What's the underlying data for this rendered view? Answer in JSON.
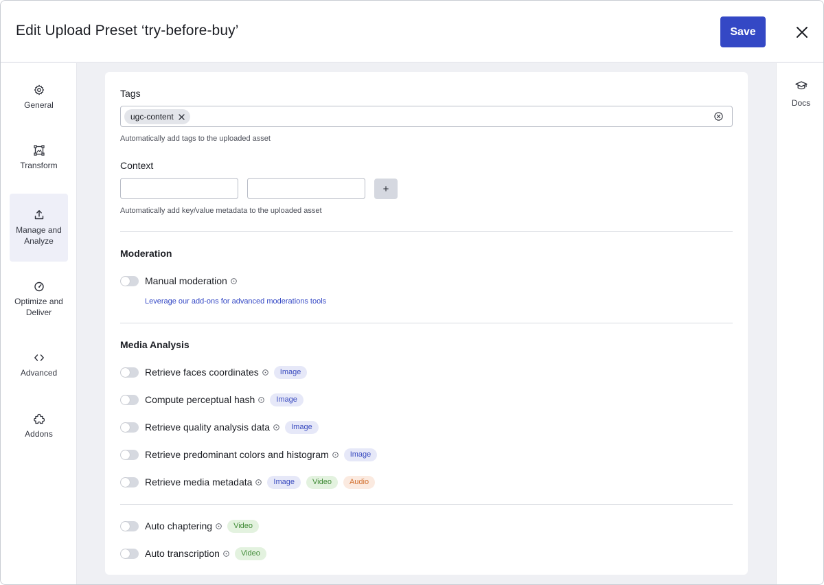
{
  "header": {
    "title": "Edit Upload Preset ‘try-before-buy’",
    "save_label": "Save"
  },
  "sidebar": {
    "items": [
      {
        "label": "General",
        "icon": "gear-icon"
      },
      {
        "label": "Transform",
        "icon": "crop-icon"
      },
      {
        "label": "Manage and Analyze",
        "icon": "upload-icon",
        "active": true
      },
      {
        "label": "Optimize and Deliver",
        "icon": "gauge-icon"
      },
      {
        "label": "Advanced",
        "icon": "code-icon"
      },
      {
        "label": "Addons",
        "icon": "puzzle-icon"
      }
    ]
  },
  "right_rail": {
    "docs_label": "Docs",
    "docs_icon": "graduation-cap-icon"
  },
  "tags": {
    "label": "Tags",
    "chips": [
      "ugc-content"
    ],
    "help": "Automatically add tags to the uploaded asset"
  },
  "context": {
    "label": "Context",
    "key_value": "",
    "value_value": "",
    "add_label": "+",
    "help": "Automatically add key/value metadata to the uploaded asset"
  },
  "moderation": {
    "title": "Moderation",
    "manual_label": "Manual moderation",
    "manual_enabled": false,
    "addons_link": "Leverage our add-ons for advanced moderations tools"
  },
  "media_analysis": {
    "title": "Media Analysis",
    "options": [
      {
        "label": "Retrieve faces coordinates",
        "enabled": false,
        "badges": [
          "Image"
        ]
      },
      {
        "label": "Compute perceptual hash",
        "enabled": false,
        "badges": [
          "Image"
        ]
      },
      {
        "label": "Retrieve quality analysis data",
        "enabled": false,
        "badges": [
          "Image"
        ]
      },
      {
        "label": "Retrieve predominant colors and histogram",
        "enabled": false,
        "badges": [
          "Image"
        ]
      },
      {
        "label": "Retrieve media metadata",
        "enabled": false,
        "badges": [
          "Image",
          "Video",
          "Audio"
        ]
      }
    ]
  },
  "video_options": [
    {
      "label": "Auto chaptering",
      "enabled": false,
      "badges": [
        "Video"
      ]
    },
    {
      "label": "Auto transcription",
      "enabled": false,
      "badges": [
        "Video"
      ]
    }
  ],
  "colors": {
    "accent": "#3448c5",
    "image_badge_bg": "#e6e8f8",
    "video_badge_bg": "#e3f2df",
    "audio_badge_bg": "#fbeae0"
  }
}
